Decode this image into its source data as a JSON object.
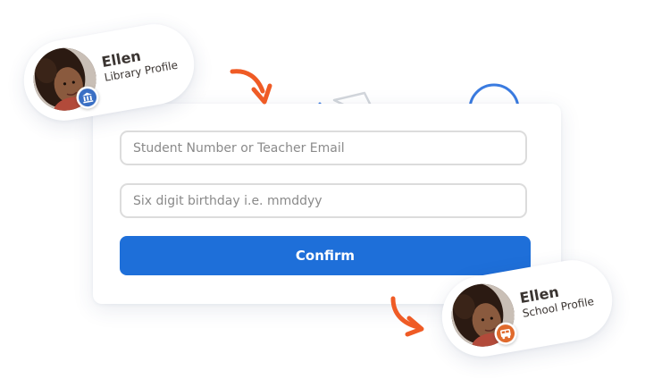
{
  "login_form": {
    "id_field": {
      "placeholder": "Student Number or Teacher Email",
      "value": ""
    },
    "birthday_field": {
      "placeholder": "Six digit birthday i.e. mmddyy",
      "value": ""
    },
    "confirm_button": {
      "label": "Confirm"
    }
  },
  "profiles": {
    "library": {
      "name": "Ellen",
      "role": "Library Profile",
      "badge_icon": "library-building-icon"
    },
    "school": {
      "name": "Ellen",
      "role": "School Profile",
      "badge_icon": "school-bus-icon"
    }
  },
  "colors": {
    "primary_button": "#1e6fd9",
    "arrow": "#ef5b25",
    "deco_blue": "#3a7be0",
    "deco_red": "#e87a7a",
    "deco_gray": "#cfd3d8",
    "badge_library": "#3a6fc4",
    "badge_school": "#e06a2c"
  }
}
